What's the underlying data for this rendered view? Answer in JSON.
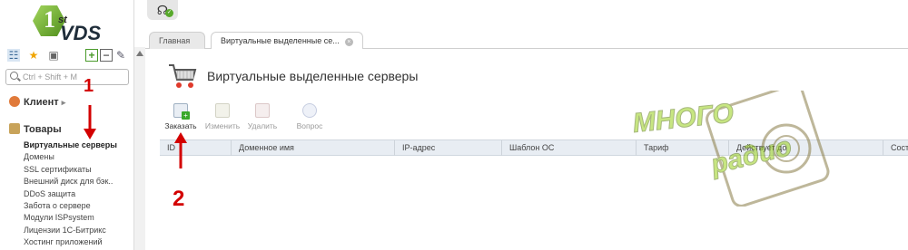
{
  "logo": {
    "num": "1",
    "sup": "st",
    "text": "VDS"
  },
  "search": {
    "placeholder": "Ctrl + Shift + M"
  },
  "sidebar": {
    "groups": [
      {
        "label": "Клиент"
      },
      {
        "label": "Товары"
      }
    ],
    "items": [
      {
        "label": "Виртуальные серверы",
        "active": true
      },
      {
        "label": "Домены"
      },
      {
        "label": "SSL сертификаты"
      },
      {
        "label": "Внешний диск для бэк.."
      },
      {
        "label": "DDoS защита"
      },
      {
        "label": "Забота о сервере"
      },
      {
        "label": "Модули ISPsystem"
      },
      {
        "label": "Лицензии 1С-Битрикс"
      },
      {
        "label": "Хостинг приложений"
      }
    ]
  },
  "tabs": [
    {
      "label": "Главная"
    },
    {
      "label": "Виртуальные выделенные се..."
    }
  ],
  "page": {
    "title": "Виртуальные выделенные серверы"
  },
  "toolbar": {
    "order": "Заказать",
    "edit": "Изменить",
    "delete": "Удалить",
    "question": "Вопрос"
  },
  "table": {
    "columns": [
      "ID",
      "Доменное имя",
      "IP-адрес",
      "Шаблон ОС",
      "Тариф",
      "Действует до",
      "Сост"
    ]
  },
  "annotations": {
    "one": "1",
    "two": "2"
  },
  "watermark": {
    "line1": "МНОГО",
    "line2": "радио"
  },
  "colors": {
    "accent": "#58a92b",
    "annotation": "#d30000",
    "header_bg": "#e8edf3"
  }
}
